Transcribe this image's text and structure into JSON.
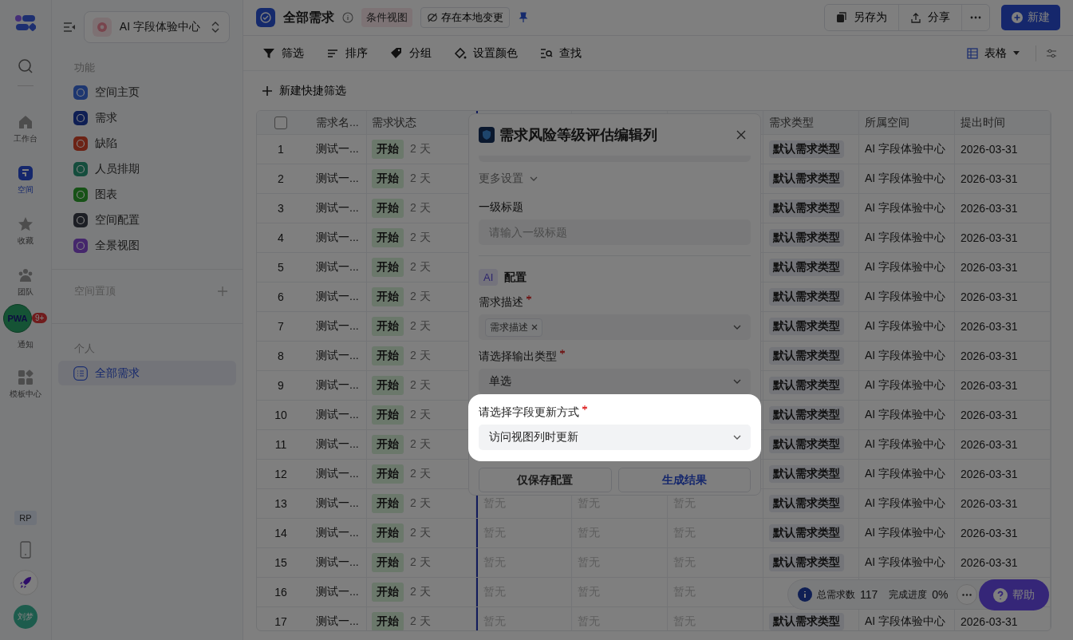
{
  "rail": {
    "items": [
      {
        "kind": "home",
        "label": "工作台",
        "selected": false
      },
      {
        "kind": "space",
        "label": "空间",
        "selected": true
      },
      {
        "kind": "star",
        "label": "收藏",
        "selected": false
      },
      {
        "kind": "team",
        "label": "团队",
        "selected": false
      },
      {
        "kind": "bell",
        "label": "通知",
        "selected": false,
        "badge": "9+"
      },
      {
        "kind": "grid",
        "label": "模板中心",
        "selected": false
      }
    ],
    "pwa": "PWA",
    "tag": "RP",
    "avatar": "刘梦"
  },
  "sidebar": {
    "space": "AI 字段体验中心",
    "functions": {
      "title": "功能",
      "items": [
        {
          "label": "空间主页",
          "color": "#1e3770",
          "selected": false
        },
        {
          "label": "需求",
          "color": "#0f1f54",
          "selected": false
        },
        {
          "label": "缺陷",
          "color": "#6c2315",
          "selected": false
        },
        {
          "label": "人员排期",
          "color": "#154d3d",
          "selected": false
        },
        {
          "label": "图表",
          "color": "#175217",
          "selected": false
        },
        {
          "label": "空间配置",
          "color": "#1d1f25",
          "selected": false
        },
        {
          "label": "全景视图",
          "color": "#45276c",
          "selected": false
        }
      ]
    },
    "pinned": {
      "title": "空间置顶"
    },
    "personal": {
      "title": "个人",
      "items": [
        {
          "label": "全部需求",
          "selected": true
        }
      ]
    }
  },
  "header": {
    "title": "全部需求",
    "view_tag": "条件视图",
    "local_changes": "存在本地变更",
    "actions": [
      {
        "kind": "save_as",
        "label": "另存为"
      },
      {
        "kind": "share",
        "label": "分享"
      }
    ],
    "new_button": "新建"
  },
  "toolbar": {
    "tools": [
      {
        "kind": "filter",
        "label": "筛选"
      },
      {
        "kind": "sort",
        "label": "排序"
      },
      {
        "kind": "group",
        "label": "分组"
      },
      {
        "kind": "color",
        "label": "设置颜色"
      },
      {
        "kind": "find",
        "label": "查找"
      }
    ],
    "view": "表格"
  },
  "quick_filter": "新建快捷筛选",
  "table": {
    "select_all": {
      "checked": false
    },
    "columns": [
      "需求名...",
      "需求状态",
      "需求类型",
      "所属空间",
      "提出时间"
    ],
    "rows": [
      {
        "index": "1",
        "name": "测试一...",
        "status": "开始",
        "duration": "2 天",
        "type": "默认需求类型",
        "space": "AI 字段体验中心",
        "date": "2026-03-31"
      },
      {
        "index": "2",
        "name": "测试一...",
        "status": "开始",
        "duration": "2 天",
        "type": "默认需求类型",
        "space": "AI 字段体验中心",
        "date": "2026-03-31"
      },
      {
        "index": "3",
        "name": "测试一...",
        "status": "开始",
        "duration": "2 天",
        "type": "默认需求类型",
        "space": "AI 字段体验中心",
        "date": "2026-03-31"
      },
      {
        "index": "4",
        "name": "测试一...",
        "status": "开始",
        "duration": "2 天",
        "type": "默认需求类型",
        "space": "AI 字段体验中心",
        "date": "2026-03-31"
      },
      {
        "index": "5",
        "name": "测试一...",
        "status": "开始",
        "duration": "2 天",
        "type": "默认需求类型",
        "space": "AI 字段体验中心",
        "date": "2026-03-31"
      },
      {
        "index": "6",
        "name": "测试一...",
        "status": "开始",
        "duration": "2 天",
        "type": "默认需求类型",
        "space": "AI 字段体验中心",
        "date": "2026-03-31"
      },
      {
        "index": "7",
        "name": "测试一...",
        "status": "开始",
        "duration": "2 天",
        "type": "默认需求类型",
        "space": "AI 字段体验中心",
        "date": "2026-03-31"
      },
      {
        "index": "8",
        "name": "测试一...",
        "status": "开始",
        "duration": "2 天",
        "type": "默认需求类型",
        "space": "AI 字段体验中心",
        "date": "2026-03-31"
      },
      {
        "index": "9",
        "name": "测试一...",
        "status": "开始",
        "duration": "2 天",
        "type": "默认需求类型",
        "space": "AI 字段体验中心",
        "date": "2026-03-31"
      },
      {
        "index": "10",
        "name": "测试一...",
        "status": "开始",
        "duration": "2 天",
        "type": "默认需求类型",
        "space": "AI 字段体验中心",
        "date": "2026-03-31"
      },
      {
        "index": "11",
        "name": "测试一...",
        "status": "开始",
        "duration": "2 天",
        "type": "默认需求类型",
        "space": "AI 字段体验中心",
        "date": "2026-03-31"
      },
      {
        "index": "12",
        "name": "测试一...",
        "status": "开始",
        "duration": "2 天",
        "type": "默认需求类型",
        "space": "AI 字段体验中心",
        "date": "2026-03-31"
      },
      {
        "index": "13",
        "name": "测试一...",
        "status": "开始",
        "duration": "2 天",
        "column_4": "暂无",
        "column_5": "暂无",
        "column_6": "暂无",
        "type": "默认需求类型",
        "space": "AI 字段体验中心",
        "date": "2026-03-31"
      },
      {
        "index": "14",
        "name": "测试一...",
        "status": "开始",
        "duration": "2 天",
        "column_4": "暂无",
        "column_5": "暂无",
        "column_6": "暂无",
        "type": "默认需求类型",
        "space": "AI 字段体验中心",
        "date": "2026-03-31"
      },
      {
        "index": "15",
        "name": "测试一...",
        "status": "开始",
        "duration": "2 天",
        "column_4": "暂无",
        "column_5": "暂无",
        "column_6": "暂无",
        "type": "默认需求类型",
        "space": "AI 字段体验中心",
        "date": "2026-03-31"
      },
      {
        "index": "16",
        "name": "测试一...",
        "status": "开始",
        "duration": "2 天",
        "column_4": "暂无",
        "column_5": "暂无",
        "column_6": "暂无"
      },
      {
        "index": "17",
        "name": "测试一...",
        "status": "开始",
        "duration": "2 天",
        "column_4": "暂无",
        "column_5": "暂无",
        "column_6": "暂无",
        "type": "默认需求类型",
        "space": "AI 字段体验中心",
        "date": "2026-03-31"
      }
    ]
  },
  "modal": {
    "title": "需求风险等级评估编辑列",
    "more_settings": "更多设置",
    "fields": [
      {
        "kind": "input",
        "label": "一级标题",
        "placeholder": "请输入一级标题"
      },
      {
        "kind": "section",
        "badge": "AI",
        "label": "配置"
      },
      {
        "kind": "tags",
        "label": "需求描述",
        "required": true,
        "tags": [
          "需求描述"
        ]
      },
      {
        "kind": "select",
        "label": "请选择输出类型",
        "required": true,
        "value": "单选",
        "highlighted": false
      },
      {
        "kind": "select",
        "label": "请选择字段更新方式",
        "required": true,
        "value": "访问视图列时更新",
        "highlighted": true
      }
    ],
    "buttons": [
      {
        "label": "仅保存配置",
        "primary": false
      },
      {
        "label": "生成结果",
        "primary": true
      }
    ]
  },
  "stats": {
    "total_label": "总需求数",
    "total": "117",
    "progress_label": "完成进度",
    "progress": "0%"
  },
  "help": "帮助"
}
